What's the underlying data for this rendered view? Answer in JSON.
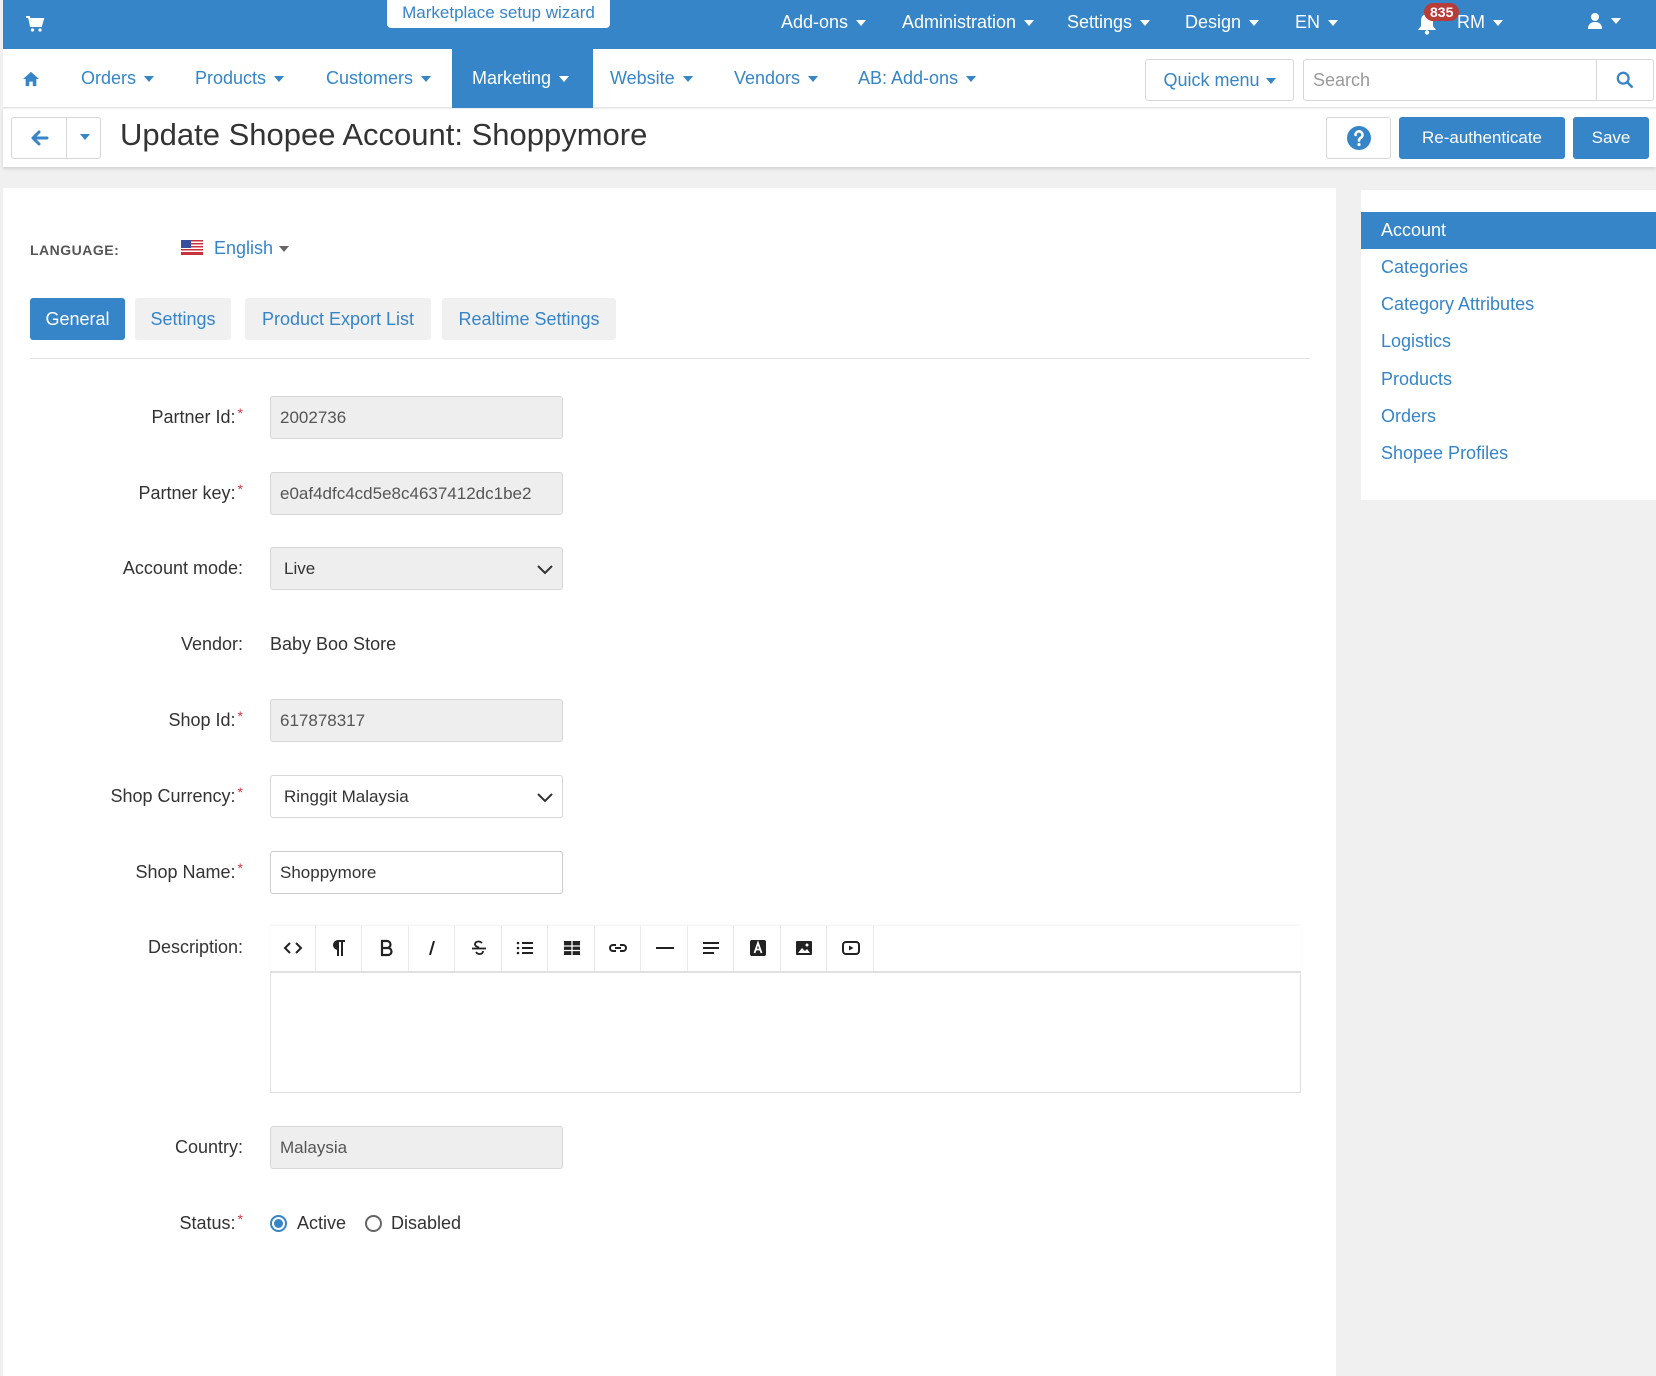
{
  "topbar": {
    "wizard_label": "Marketplace setup wizard",
    "items": [
      "Add-ons",
      "Administration",
      "Settings",
      "Design",
      "EN",
      "RM"
    ],
    "notifications_count": "835",
    "icons": [
      "cart-icon",
      "bell-icon",
      "user-icon"
    ]
  },
  "navbar": {
    "items": [
      "Orders",
      "Products",
      "Customers",
      "Marketing",
      "Website",
      "Vendors",
      "AB: Add-ons"
    ],
    "active": "Marketing",
    "quick_menu": "Quick menu",
    "search_placeholder": "Search"
  },
  "titlebar": {
    "title": "Update Shopee Account: Shoppymore",
    "reauth": "Re-authenticate",
    "save": "Save"
  },
  "form": {
    "language_label": "LANGUAGE:",
    "language_value": "English",
    "tabs": [
      "General",
      "Settings",
      "Product Export List",
      "Realtime Settings"
    ],
    "active_tab": "General",
    "partner_id_label": "Partner Id:",
    "partner_id": "2002736",
    "partner_key_label": "Partner key:",
    "partner_key": "e0af4dfc4cd5e8c4637412dc1be2",
    "account_mode_label": "Account mode:",
    "account_mode": "Live",
    "vendor_label": "Vendor:",
    "vendor": "Baby Boo Store",
    "shop_id_label": "Shop Id:",
    "shop_id": "617878317",
    "shop_currency_label": "Shop Currency:",
    "shop_currency": "Ringgit Malaysia",
    "shop_name_label": "Shop Name:",
    "shop_name": "Shoppymore",
    "description_label": "Description:",
    "country_label": "Country:",
    "country": "Malaysia",
    "status_label": "Status:",
    "status_options": [
      "Active",
      "Disabled"
    ],
    "status_selected": "Active",
    "required_mark": "*"
  },
  "sidebar": {
    "items": [
      "Account",
      "Categories",
      "Category Attributes",
      "Logistics",
      "Products",
      "Orders",
      "Shopee Profiles"
    ],
    "active": "Account"
  },
  "colors": {
    "primary": "#3585c8",
    "badge": "#b83c38",
    "required": "#d9363e"
  }
}
